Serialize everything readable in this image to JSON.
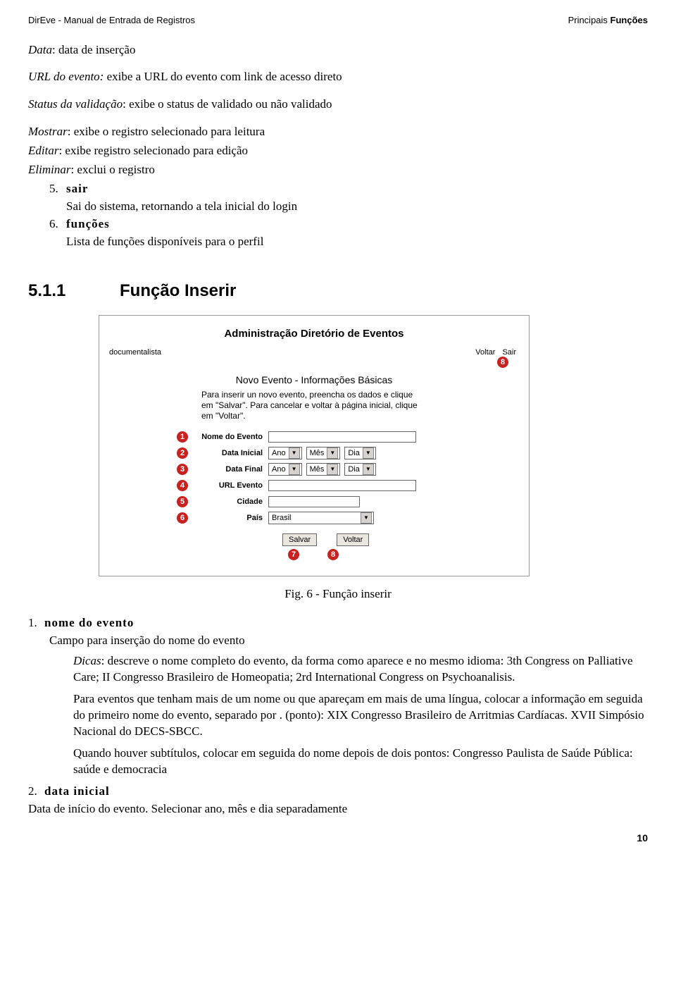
{
  "header": {
    "left": "DirEve - Manual de Entrada de Registros",
    "right_prefix": "Principais",
    "right_bold": " Funções"
  },
  "defs": {
    "data_label": "Data",
    "data_text": ": data de inserção",
    "url_label": "URL do evento:",
    "url_text": " exibe a URL do evento com link de acesso direto",
    "status_label": "Status da validação",
    "status_text": ": exibe o status de validado ou não validado",
    "mostrar_label": "Mostrar",
    "mostrar_text": ": exibe o registro selecionado para leitura",
    "editar_label": "Editar",
    "editar_text": ": exibe registro selecionado para edição",
    "eliminar_label": "Eliminar",
    "eliminar_text": ": exclui o registro"
  },
  "list5": {
    "num": "5.",
    "title": "sair",
    "desc": "Sai do sistema, retornando a tela inicial do login"
  },
  "list6": {
    "num": "6.",
    "title": "funções",
    "desc": "Lista de funções disponíveis para o perfil"
  },
  "section": {
    "num": "5.1.1",
    "title": "Função Inserir"
  },
  "shot": {
    "title": "Administração Diretório de Eventos",
    "user": "documentalista",
    "link_voltar": "Voltar",
    "link_sair": "Sair",
    "badge_top": "8",
    "subtitle": "Novo Evento - Informações Básicas",
    "instr": "Para inserir un novo evento, preencha os dados e clique em \"Salvar\". Para cancelar e voltar à página inicial, clique em \"Voltar\".",
    "rows": {
      "r1": {
        "b": "1",
        "label": "Nome do Evento"
      },
      "r2": {
        "b": "2",
        "label": "Data Inicial"
      },
      "r3": {
        "b": "3",
        "label": "Data Final"
      },
      "r4": {
        "b": "4",
        "label": "URL Evento"
      },
      "r5": {
        "b": "5",
        "label": "Cidade"
      },
      "r6": {
        "b": "6",
        "label": "País"
      }
    },
    "sel": {
      "ano": "Ano",
      "mes": "Mês",
      "dia": "Dia",
      "pais": "Brasil"
    },
    "btn_salvar": "Salvar",
    "btn_voltar": "Voltar",
    "badge7": "7",
    "badge8": "8"
  },
  "fig_caption": "Fig. 6 - Função inserir",
  "lower": {
    "i1_num": "1.",
    "i1_title": "nome do evento",
    "i1_line": "Campo para inserção do nome do evento",
    "i1_dicas_label": "Dicas",
    "i1_dicas": ": descreve o nome completo do evento, da forma como aparece e no mesmo idioma: 3th Congress on Palliative Care; II Congresso Brasileiro de Homeopatia; 2rd International Congress on Psychoanalisis.",
    "i1_p2": "Para eventos que tenham mais de um nome ou que apareçam em mais de uma língua, colocar a informação em seguida do primeiro nome do evento, separado por . (ponto): XIX Congresso Brasileiro de Arritmias Cardíacas. XVII Simpósio Nacional do DECS-SBCC.",
    "i1_p3": "Quando houver subtítulos, colocar em seguida do nome depois de dois pontos: Congresso Paulista de Saúde Pública: saúde e democracia",
    "i2_num": "2.",
    "i2_title": "data inicial",
    "i2_line": "Data de início do evento. Selecionar ano, mês e dia separadamente"
  },
  "pagenum": "10"
}
